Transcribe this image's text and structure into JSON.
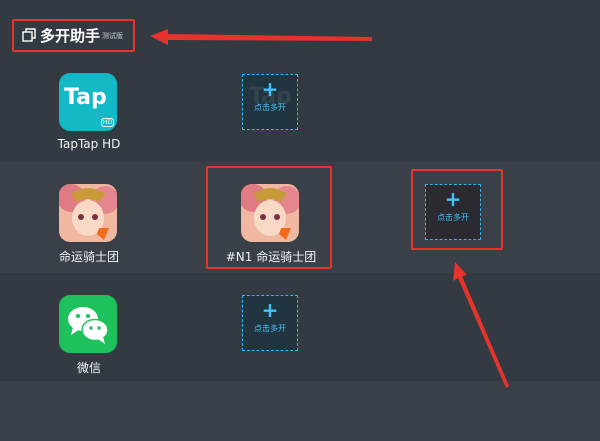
{
  "header": {
    "title": "多开助手",
    "subtitle": "测试版",
    "icon": "multi-window-icon"
  },
  "apps": [
    {
      "label": "TapTap HD",
      "icon": "taptap-logo-icon",
      "icon_text": "Tap",
      "icon_badge": "HD",
      "color": "#14b9c8",
      "add_label": "点击多开"
    },
    {
      "label": "命运骑士团",
      "icon": "fate-knights-icon",
      "clone_label": "#N1 命运骑士团",
      "add_label": "点击多开"
    },
    {
      "label": "微信",
      "icon": "wechat-icon",
      "color": "#1fc15c",
      "add_label": "点击多开"
    }
  ],
  "add_plus": "+",
  "colors": {
    "accent": "#32b3ef",
    "highlight": "#e8322c",
    "background": "#343a41"
  }
}
